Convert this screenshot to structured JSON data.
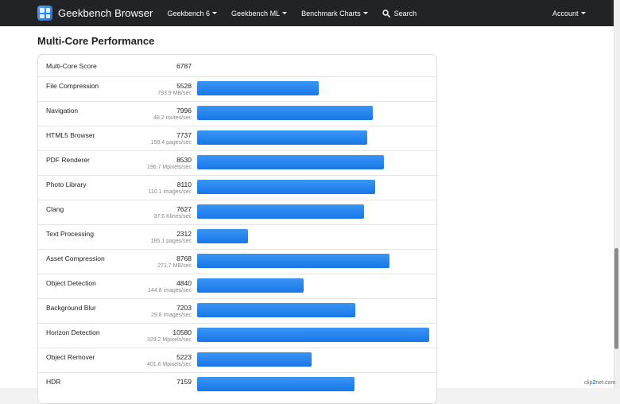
{
  "nav": {
    "brand": "Geekbench Browser",
    "items": [
      "Geekbench 6",
      "Geekbench ML",
      "Benchmark Charts"
    ],
    "search": "Search",
    "account": "Account"
  },
  "page": {
    "title": "Multi-Core Performance"
  },
  "total": {
    "label": "Multi-Core Score",
    "score": "6787"
  },
  "max_score": 10580,
  "benchmarks": [
    {
      "name": "File Compression",
      "score": 5528,
      "unit": "793.9 MB/sec"
    },
    {
      "name": "Navigation",
      "score": 7996,
      "unit": "48.2 routes/sec"
    },
    {
      "name": "HTML5 Browser",
      "score": 7737,
      "unit": "158.4 pages/sec"
    },
    {
      "name": "PDF Renderer",
      "score": 8530,
      "unit": "196.7 Mpixels/sec"
    },
    {
      "name": "Photo Library",
      "score": 8110,
      "unit": "110.1 images/sec"
    },
    {
      "name": "Clang",
      "score": 7627,
      "unit": "37.6 Klines/sec"
    },
    {
      "name": "Text Processing",
      "score": 2312,
      "unit": "185.1 pages/sec"
    },
    {
      "name": "Asset Compression",
      "score": 8768,
      "unit": "271.7 MB/sec"
    },
    {
      "name": "Object Detection",
      "score": 4840,
      "unit": "144.8 images/sec"
    },
    {
      "name": "Background Blur",
      "score": 7203,
      "unit": "29.8 images/sec"
    },
    {
      "name": "Horizon Detection",
      "score": 10580,
      "unit": "329.2 Mpixels/sec"
    },
    {
      "name": "Object Remover",
      "score": 5223,
      "unit": "401.6 Mpixels/sec"
    },
    {
      "name": "HDR",
      "score": 7159,
      "unit": ""
    }
  ],
  "colors": {
    "bar": "#1e7fec",
    "navbar": "#222325"
  },
  "watermark": {
    "pre": "clip",
    "accent": "2",
    "post": "net.com"
  }
}
